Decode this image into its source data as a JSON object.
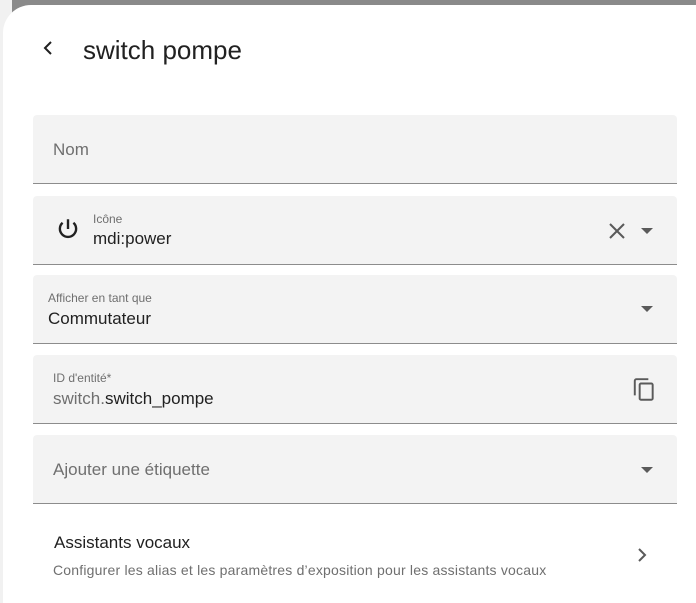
{
  "header": {
    "title": "switch pompe"
  },
  "form": {
    "name_placeholder": "Nom",
    "icon_label": "Icône",
    "icon_value": "mdi:power",
    "display_label": "Afficher en tant que",
    "display_value": "Commutateur",
    "entity_id_label": "ID d'entité*",
    "entity_id_prefix": "switch.",
    "entity_id_value": "switch_pompe",
    "label_placeholder": "Ajouter une étiquette"
  },
  "voice_assistants": {
    "title": "Assistants vocaux",
    "subtitle": "Configurer les alias et les paramètres d’exposition pour les assistants vocaux"
  },
  "icons": {
    "back": "chevron-left-icon",
    "power": "power-icon",
    "clear": "close-icon",
    "dropdown": "caret-down-icon",
    "copy": "copy-icon",
    "chevron": "chevron-right-icon"
  },
  "colors": {
    "field_background": "#f3f3f3",
    "text_primary": "#212121",
    "text_secondary": "#6f6f6f"
  }
}
